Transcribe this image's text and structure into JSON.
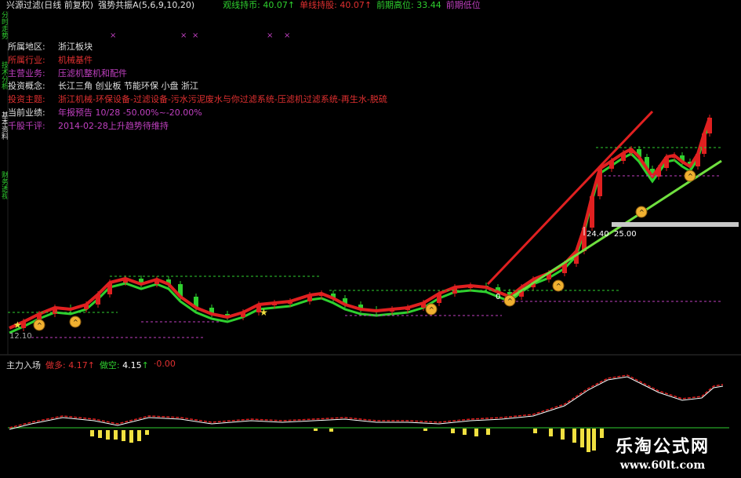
{
  "header": {
    "title": "兴源过滤(日线 前复权)",
    "indicator": "强势共振A(5,6,9,10,20)",
    "fields": [
      {
        "label": "观线持币:",
        "value": "40.07",
        "color": "#2fd02f"
      },
      {
        "label": "单线持股:",
        "value": "40.07",
        "color": "#e03030"
      },
      {
        "label": "前期高位:",
        "value": "33.44",
        "color": "#2fd02f"
      },
      {
        "label": "前期低位",
        "value": "",
        "color": "#c040c0"
      }
    ]
  },
  "sidebar": {
    "items": [
      "分时走势",
      "技术分析",
      "基本资料",
      "财务透视"
    ]
  },
  "info": {
    "rows": [
      {
        "label": "所属地区:",
        "value": "浙江板块",
        "label_color": "#e0e0e0",
        "value_color": "#e0e0e0"
      },
      {
        "label": "所属行业:",
        "value": "机械基件",
        "label_color": "#e03030",
        "value_color": "#e03030"
      },
      {
        "label": "主营业务:",
        "value": "压滤机整机和配件",
        "label_color": "#c040c0",
        "value_color": "#c040c0"
      },
      {
        "label": "投资概念:",
        "value": "长江三角 创业板 节能环保 小盘 浙江",
        "label_color": "#e0e0e0",
        "value_color": "#e0e0e0"
      },
      {
        "label": "投资主题:",
        "value": "浙江机械-环保设备-过滤设备-污水污泥废水与你过滤系统-压滤机过滤系统-再生水-脱硫",
        "label_color": "#e03030",
        "value_color": "#e03030"
      },
      {
        "label": "当前业绩:",
        "value": "年报预告 10/28 -50.00%~-20.00%",
        "label_color": "#e0e0e0",
        "value_color": "#c040c0"
      },
      {
        "label": "千股千评:",
        "value": "2014-02-28上升趋势待维持",
        "label_color": "#c040c0",
        "value_color": "#c040c0"
      }
    ]
  },
  "price_labels": {
    "a": "24.40",
    "b": "25.00",
    "low": "12.10",
    "zero": "0"
  },
  "lower": {
    "title": "主力入场",
    "fields": [
      {
        "label": "做多:",
        "value": "4.17",
        "color": "#e03030"
      },
      {
        "label": "做空:",
        "value": "4.15",
        "color": "#2fd02f"
      },
      {
        "label": "",
        "value": "0.00",
        "color": "#e03030"
      }
    ]
  },
  "watermark": {
    "line1": "乐淘公式网",
    "line2": "www.60lt.com"
  },
  "colors": {
    "up": "#e02020",
    "down": "#2fd02f",
    "ma": "#2fd02f",
    "trend": "#e02020",
    "dotted_green": "#2fd02f",
    "dotted_purple": "#c040c0",
    "bar": "#f0e040"
  }
}
